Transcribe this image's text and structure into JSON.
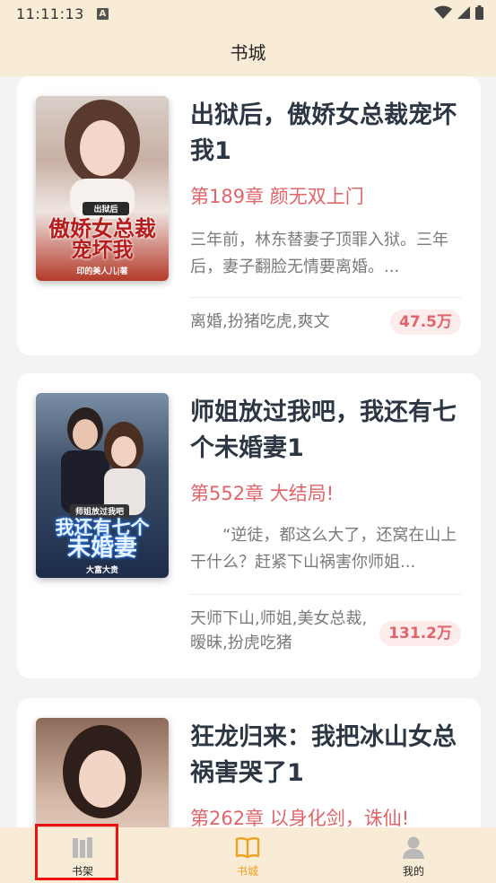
{
  "status": {
    "time": "11:11:13",
    "indicator": "A"
  },
  "header": {
    "title": "书城"
  },
  "books": [
    {
      "title": "出狱后，傲娇女总裁宠坏我1",
      "chapter": "第189章 颜无双上门",
      "intro": "三年前，林东替妻子顶罪入狱。三年后，妻子翻脸无情要离婚。...",
      "tags": "离婚,扮猪吃虎,爽文",
      "count": "47.5万",
      "cover": {
        "line1": "傲娇女总裁",
        "line2": "宠坏我",
        "top_text": "出狱后",
        "bottom_text": "印的美人儿|著"
      }
    },
    {
      "title": "师姐放过我吧，我还有七个未婚妻1",
      "chapter": "第552章 大结局!",
      "intro": "“逆徒，都这么大了，还窝在山上干什么？赶紧下山祸害你师姐...",
      "tags": "天师下山,师姐,美女总裁,暧昧,扮虎吃猪",
      "count": "131.2万",
      "cover": {
        "line1": "我还有七个",
        "line2": "未婚妻",
        "top_text": "师姐放过我吧",
        "bottom_text": "大富大贵"
      }
    },
    {
      "title": "狂龙归来：我把冰山女总祸害哭了1",
      "chapter": "第262章 以身化剑，诛仙!"
    }
  ],
  "tabs": [
    {
      "label": "书架",
      "icon": "bookshelf-icon",
      "active": false
    },
    {
      "label": "书城",
      "icon": "open-book-icon",
      "active": true
    },
    {
      "label": "我的",
      "icon": "user-icon",
      "active": false
    }
  ],
  "colors": {
    "accent": "#e0656a",
    "active_tab": "#f0a020",
    "bar": "#f9ecd7",
    "highlight_box": "#e11111"
  }
}
